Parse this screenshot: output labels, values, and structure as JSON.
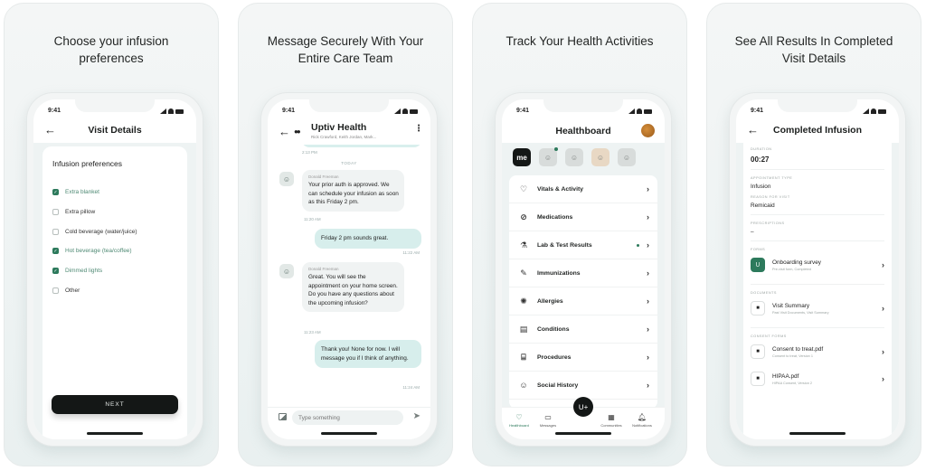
{
  "status_time": "9:41",
  "panels": [
    {
      "title": "Choose your infusion preferences",
      "nav_title": "Visit Details",
      "heading": "Infusion preferences",
      "options": [
        {
          "label": "Extra blanket",
          "checked": true
        },
        {
          "label": "Extra pillow",
          "checked": false
        },
        {
          "label": "Cold beverage (water/juice)",
          "checked": false
        },
        {
          "label": "Hot beverage (tea/coffee)",
          "checked": true
        },
        {
          "label": "Dimmed lights",
          "checked": true
        },
        {
          "label": "Other",
          "checked": false
        }
      ],
      "next_label": "NEXT"
    },
    {
      "title": "Message Securely With Your Entire Care Team",
      "chat_title": "Uptiv Health",
      "chat_subtitle": "Rick Crawford, Keith Jordan, Mark...",
      "first_timestamp": "2:13 PM",
      "day_label": "TODAY",
      "messages": [
        {
          "direction": "in",
          "sender": "Donald Freeman",
          "text": "Your prior auth is approved. We can schedule your infusion as soon as this Friday 2 pm.",
          "time": "11:20 AM"
        },
        {
          "direction": "out",
          "text": "Friday 2 pm sounds great.",
          "time": "11:22 AM"
        },
        {
          "direction": "in",
          "sender": "Donald Freeman",
          "text": "Great. You will see the appointment on your home screen. Do you have any questions about the upcoming infusion?",
          "time": "11:23 AM"
        },
        {
          "direction": "out",
          "text": "Thank you! None for now. I will message you if I think of anything.",
          "time": "11:24 AM"
        }
      ],
      "composer_placeholder": "Type something"
    },
    {
      "title": "Track Your Health Activities",
      "nav_title": "Healthboard",
      "me_label": "me",
      "rows": [
        {
          "icon": "heart-pulse-icon",
          "glyph": "♡",
          "label": "Vitals & Activity",
          "dot": false
        },
        {
          "icon": "pills-icon",
          "glyph": "⊘",
          "label": "Medications",
          "dot": false
        },
        {
          "icon": "flask-icon",
          "glyph": "⚗",
          "label": "Lab & Test Results",
          "dot": true
        },
        {
          "icon": "syringe-icon",
          "glyph": "✎",
          "label": "Immunizations",
          "dot": false
        },
        {
          "icon": "allergy-icon",
          "glyph": "✺",
          "label": "Allergies",
          "dot": false
        },
        {
          "icon": "clipboard-icon",
          "glyph": "▤",
          "label": "Conditions",
          "dot": false
        },
        {
          "icon": "bed-icon",
          "glyph": "⌸",
          "label": "Procedures",
          "dot": false
        },
        {
          "icon": "head-icon",
          "glyph": "☺",
          "label": "Social History",
          "dot": false
        }
      ],
      "tabs": [
        {
          "label": "Healthboard",
          "glyph": "♡",
          "active": true
        },
        {
          "label": "Messages",
          "glyph": "▭",
          "active": false
        },
        {
          "label": "Communities",
          "glyph": "▦",
          "active": false
        },
        {
          "label": "Notifications",
          "glyph": "♫",
          "active": false
        }
      ]
    },
    {
      "title": "See All Results In Completed Visit Details",
      "nav_title": "Completed Infusion",
      "duration_label": "DURATION",
      "duration_value": "00:27",
      "appointment_type_label": "APPOINTMENT TYPE",
      "appointment_type_value": "Infusion",
      "reason_label": "REASON FOR VISIT",
      "reason_value": "Remicaid",
      "prescriptions_label": "PRESCRIPTIONS",
      "prescriptions_value": "–",
      "forms_label": "FORMS",
      "forms": [
        {
          "title": "Onboarding survey",
          "subtitle": "Pre-visit form, Completed"
        }
      ],
      "documents_label": "DOCUMENTS",
      "documents": [
        {
          "title": "Visit Summary",
          "subtitle": "Past Visit Documents, Visit Summary"
        }
      ],
      "consent_label": "CONSENT FORMS",
      "consent_forms": [
        {
          "title": "Consent to treat.pdf",
          "subtitle": "Consent to treat, Version 1"
        },
        {
          "title": "HIPAA.pdf",
          "subtitle": "HIPAA Consent, Version 2"
        }
      ]
    }
  ]
}
